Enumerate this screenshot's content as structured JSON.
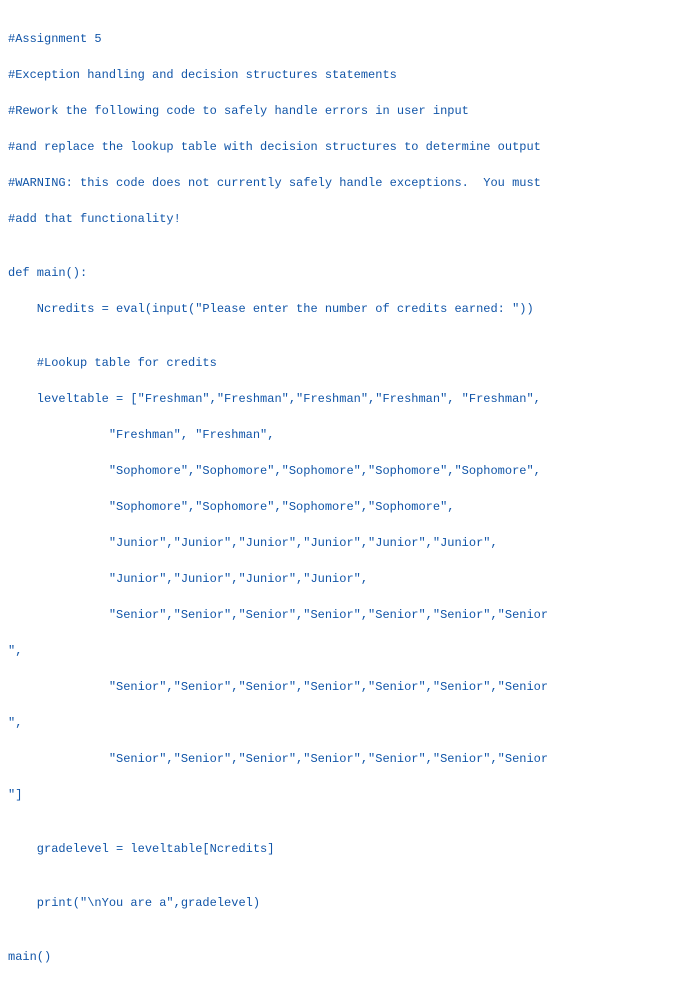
{
  "lines": [
    "#Assignment 5",
    "#Exception handling and decision structures statements",
    "#Rework the following code to safely handle errors in user input",
    "#and replace the lookup table with decision structures to determine output",
    "#WARNING: this code does not currently safely handle exceptions.  You must",
    "#add that functionality!",
    "",
    "def main():",
    "    Ncredits = eval(input(\"Please enter the number of credits earned: \"))",
    "",
    "    #Lookup table for credits",
    "    leveltable = [\"Freshman\",\"Freshman\",\"Freshman\",\"Freshman\", \"Freshman\",",
    "              \"Freshman\", \"Freshman\",",
    "              \"Sophomore\",\"Sophomore\",\"Sophomore\",\"Sophomore\",\"Sophomore\",",
    "              \"Sophomore\",\"Sophomore\",\"Sophomore\",\"Sophomore\",",
    "              \"Junior\",\"Junior\",\"Junior\",\"Junior\",\"Junior\",\"Junior\",",
    "              \"Junior\",\"Junior\",\"Junior\",\"Junior\",",
    "              \"Senior\",\"Senior\",\"Senior\",\"Senior\",\"Senior\",\"Senior\",\"Senior",
    "\",",
    "              \"Senior\",\"Senior\",\"Senior\",\"Senior\",\"Senior\",\"Senior\",\"Senior",
    "\",",
    "              \"Senior\",\"Senior\",\"Senior\",\"Senior\",\"Senior\",\"Senior\",\"Senior",
    "\"]",
    "",
    "    gradelevel = leveltable[Ncredits]",
    "",
    "    print(\"\\nYou are a\",gradelevel)",
    "",
    "main()"
  ]
}
